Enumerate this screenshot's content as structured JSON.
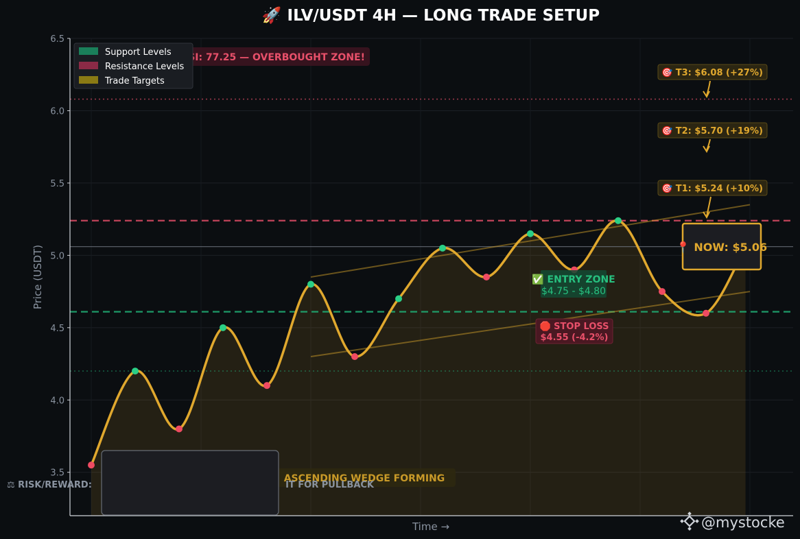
{
  "page": {
    "background": "#0b0e11",
    "watermark_text": "@mystocke",
    "risk_reward_label": "⚖ RISK/REWARD:",
    "risk_reward_suffix": "IT FOR PULLBACK"
  },
  "chart_data": {
    "type": "line",
    "title": "🚀 ILV/USDT 4H — LONG TRADE SETUP",
    "xlabel": "Time →",
    "ylabel": "Price (USDT)",
    "ylim": [
      3.2,
      6.5
    ],
    "yticks": [
      "3.5",
      "4.0",
      "4.5",
      "5.0",
      "5.5",
      "6.0",
      "6.5"
    ],
    "grid": true,
    "legend_position": "top-left",
    "legend": [
      {
        "label": "Support Levels",
        "color": "#1a7f5a"
      },
      {
        "label": "Resistance Levels",
        "color": "#8b2a46"
      },
      {
        "label": "Trade Targets",
        "color": "#8a7a14"
      }
    ],
    "colors": {
      "price_line": "#e0a82e",
      "support": "#1fa971",
      "resistance": "#d64a63",
      "target": "#e0a82e"
    },
    "swing_points": [
      {
        "x": 0,
        "y": 3.55,
        "kind": "low"
      },
      {
        "x": 1,
        "y": 4.2,
        "kind": "high"
      },
      {
        "x": 2,
        "y": 3.8,
        "kind": "low"
      },
      {
        "x": 3,
        "y": 4.5,
        "kind": "high"
      },
      {
        "x": 4,
        "y": 4.1,
        "kind": "low"
      },
      {
        "x": 5,
        "y": 4.8,
        "kind": "high"
      },
      {
        "x": 6,
        "y": 4.3,
        "kind": "low"
      },
      {
        "x": 7,
        "y": 4.7,
        "kind": "high"
      },
      {
        "x": 8,
        "y": 5.05,
        "kind": "high"
      },
      {
        "x": 9,
        "y": 4.85,
        "kind": "low"
      },
      {
        "x": 10,
        "y": 5.15,
        "kind": "high"
      },
      {
        "x": 11,
        "y": 4.9,
        "kind": "low"
      },
      {
        "x": 12,
        "y": 5.24,
        "kind": "high"
      },
      {
        "x": 13,
        "y": 4.75,
        "kind": "low"
      },
      {
        "x": 14,
        "y": 4.6,
        "kind": "low"
      },
      {
        "x": 14.9,
        "y": 5.06,
        "kind": "end"
      }
    ],
    "levels": [
      {
        "name": "resistance",
        "y": 5.24,
        "style": "dashed"
      },
      {
        "name": "support",
        "y": 4.61,
        "style": "dashed"
      },
      {
        "name": "current",
        "y": 5.06,
        "style": "solid"
      },
      {
        "name": "t3",
        "y": 6.08,
        "style": "dotted"
      },
      {
        "name": "lower-support",
        "y": 4.2,
        "style": "dotted"
      }
    ],
    "wedge": {
      "upper": [
        [
          5,
          4.85
        ],
        [
          15,
          5.35
        ]
      ],
      "lower": [
        [
          5,
          4.3
        ],
        [
          15,
          4.75
        ]
      ]
    },
    "annotations": {
      "rsi": "RSI: 77.25 — OVERBOUGHT ZONE!",
      "t3": "🎯 T3: $6.08 (+27%)",
      "t2": "🎯 T2: $5.70 (+19%)",
      "t1": "🎯 T1: $5.24 (+10%)",
      "now": "📍 NOW: $5.06",
      "entry_title": "✅ ENTRY ZONE",
      "entry_range": "$4.75 - $4.80",
      "stop_title": "🛑 STOP LOSS",
      "stop_value": "$4.55 (-4.2%)",
      "wedge": "ASCENDING WEDGE FORMING"
    }
  }
}
